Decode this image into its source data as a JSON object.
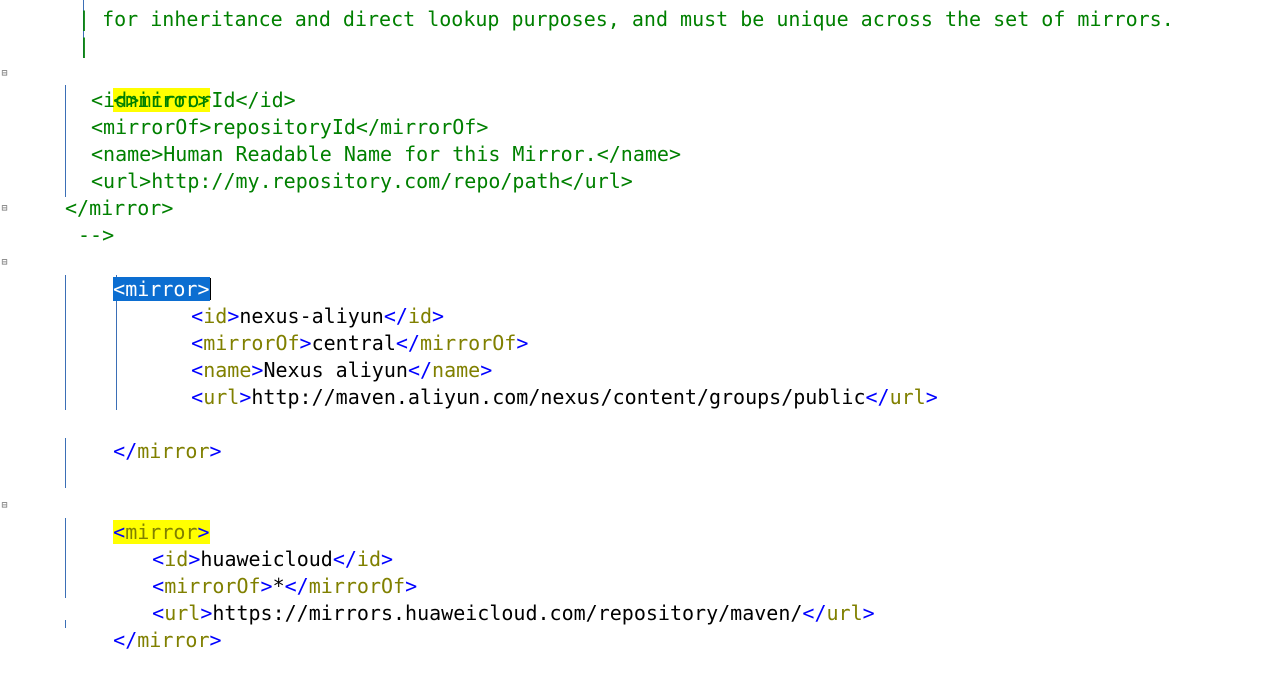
{
  "editor": {
    "comment_line_1": "| for inheritance and direct lookup purposes, and must be unique across the set of mirrors.",
    "comment_line_2": "|",
    "comment_close": "-->",
    "example_mirror": {
      "open": "<mirror>",
      "id": "<id>mirrorId</id>",
      "mirrorOf": "<mirrorOf>repositoryId</mirrorOf>",
      "name": "<name>Human Readable Name for this Mirror.</name>",
      "url": "<url>http://my.repository.com/repo/path</url>",
      "close": "</mirror>"
    },
    "mirror_aliyun": {
      "tag": "mirror",
      "id_value": "nexus-aliyun",
      "mirrorOf_value": "central",
      "name_value": "Nexus aliyun",
      "url_value": "http://maven.aliyun.com/nexus/content/groups/public"
    },
    "mirror_huawei": {
      "tag": "mirror",
      "id_value": "huaweicloud",
      "mirrorOf_value": "*",
      "url_value": "https://mirrors.huaweicloud.com/repository/maven/"
    },
    "tags": {
      "id": "id",
      "mirrorOf": "mirrorOf",
      "name": "name",
      "url": "url"
    },
    "colors": {
      "comment": "#008000",
      "bracket": "#0000ff",
      "tag": "#808000",
      "text": "#000000",
      "match_highlight": "#ffff00",
      "selection": "#0c6ed1"
    }
  }
}
